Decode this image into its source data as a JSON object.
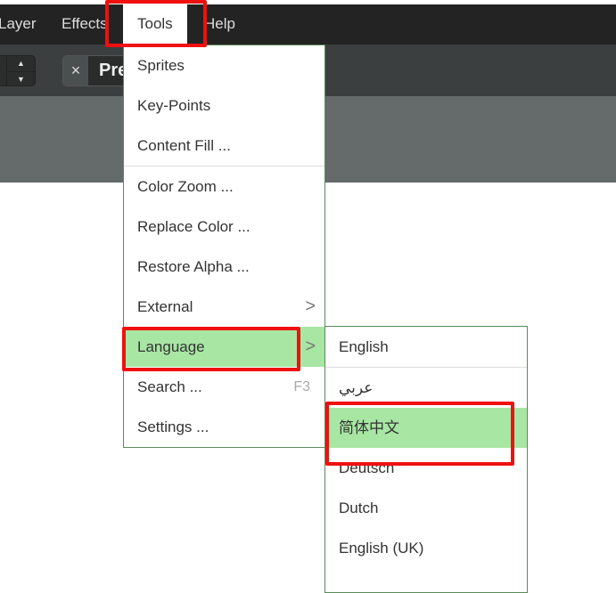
{
  "menubar": {
    "items": [
      {
        "label": "Layer"
      },
      {
        "label": "Effects"
      },
      {
        "label": "Tools"
      },
      {
        "label": "Help"
      }
    ]
  },
  "toolbar": {
    "stepper_up": "▲",
    "stepper_down": "▼",
    "tab_close": "×",
    "tab_label": "Pre"
  },
  "tools_menu": {
    "items": [
      {
        "label": "Sprites"
      },
      {
        "label": "Key-Points"
      },
      {
        "label": "Content Fill ..."
      },
      {
        "label": "Color Zoom ..."
      },
      {
        "label": "Replace Color ..."
      },
      {
        "label": "Restore Alpha ..."
      },
      {
        "label": "External"
      },
      {
        "label": "Language"
      },
      {
        "label": "Search ...",
        "shortcut": "F3"
      },
      {
        "label": "Settings ..."
      }
    ]
  },
  "language_menu": {
    "items": [
      {
        "label": "English"
      },
      {
        "label": "عربي"
      },
      {
        "label": "简体中文"
      },
      {
        "label": "Deutsch"
      },
      {
        "label": "Dutch"
      },
      {
        "label": "English (UK)"
      }
    ]
  },
  "colors": {
    "highlight": "#a8e6a3",
    "annotation": "#f01010",
    "menubar": "#232323"
  }
}
